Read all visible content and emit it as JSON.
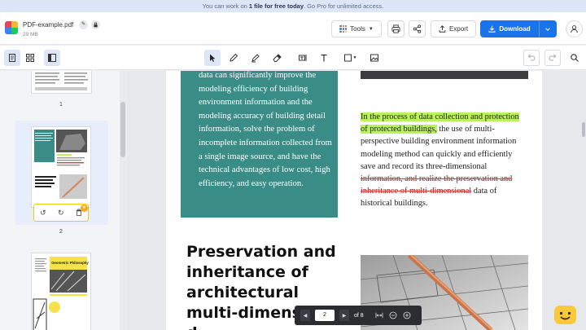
{
  "promo": {
    "before": "You can work on ",
    "bold": "1 file for free today",
    "after": ". Go Pro for unlimited access."
  },
  "header": {
    "file_name": "PDF-example.pdf",
    "file_size": "29 MB",
    "tools_label": "Tools",
    "export_label": "Export",
    "download_label": "Download"
  },
  "sidebar": {
    "pages": [
      {
        "number": "1"
      },
      {
        "number": "2"
      }
    ],
    "thumb3_title": "Geometric Philosophy"
  },
  "document": {
    "teal_paragraph": "data can significantly improve the modeling efficiency of building environment information and the modeling accuracy of building detail information, solve the problem of incomplete information collected from a single image source, and have the technical advantages of low cost, high efficiency, and easy operation.",
    "highlighted_text": "In the process of data collection and protection of protected buildings,",
    "plain_text_1": " the use of multi-perspective building environment information modeling method can quickly and efficiently save and record its three-dimensional",
    "struck_text": "information, and realize the preservation and inheritance of multi-dimensional",
    "plain_text_2": " data of historical buildings.",
    "heading": "Preservation and inheritance of architectural multi-dimensional d"
  },
  "page_nav": {
    "current_page": "2",
    "of_label": "of 8"
  },
  "colors": {
    "accent": "#1a73e8",
    "teal": "#3a8c87",
    "highlight": "#b8f35a",
    "strike": "#d33333",
    "mascot": "#f8c93a"
  }
}
